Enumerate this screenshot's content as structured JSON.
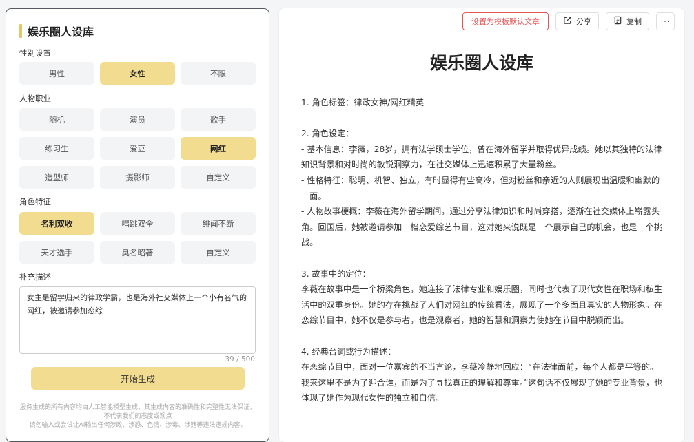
{
  "form": {
    "title": "娱乐圈人设库",
    "gender": {
      "label": "性别设置",
      "options": [
        "男性",
        "女性",
        "不限"
      ],
      "selected": "女性"
    },
    "profession": {
      "label": "人物职业",
      "options": [
        "随机",
        "演员",
        "歌手",
        "练习生",
        "爱豆",
        "网红",
        "造型师",
        "摄影师",
        "自定义"
      ],
      "selected": "网红"
    },
    "traits": {
      "label": "角色特征",
      "options": [
        "名利双收",
        "唱跳双全",
        "绯闻不断",
        "天才选手",
        "臭名昭著",
        "自定义"
      ],
      "selected": "名利双收"
    },
    "extra": {
      "label": "补充描述",
      "value": "女主是留学归来的律政学霸，也是海外社交媒体上一个小有名气的网红，被邀请参加恋综",
      "counter": "39 / 500"
    },
    "generate_label": "开始生成",
    "disclaimer": "服务生成的所有内容均由人工智能模型生成，其生成内容的准确性和完整性无法保证，不代表我们的态度或观点\n请勿输入或尝试让AI输出任何涉政、涉恐、色情、涉毒、涉赌等违法违规内容。"
  },
  "toolbar": {
    "set_default_label": "设置为模板默认文章",
    "share_label": "分享",
    "copy_label": "复制",
    "more_label": "···"
  },
  "article": {
    "title": "娱乐圈人设库",
    "paragraphs": [
      "1. 角色标签：律政女神/网红精英",
      "2. 角色设定：\n- 基本信息：李薇，28岁，拥有法学硕士学位，曾在海外留学并取得优异成绩。她以其独特的法律知识背景和对时尚的敏锐洞察力，在社交媒体上迅速积累了大量粉丝。\n- 性格特征：聪明、机智、独立，有时显得有些高冷，但对粉丝和亲近的人则展现出温暖和幽默的一面。\n- 人物故事梗概：李薇在海外留学期间，通过分享法律知识和时尚穿搭，逐渐在社交媒体上崭露头角。回国后，她被邀请参加一档恋爱综艺节目，这对她来说既是一个展示自己的机会，也是一个挑战。",
      "3. 故事中的定位：\n李薇在故事中是一个桥梁角色，她连接了法律专业和娱乐圈，同时也代表了现代女性在职场和私生活中的双重身份。她的存在挑战了人们对网红的传统看法，展现了一个多面且真实的人物形象。在恋综节目中，她不仅是参与者，也是观察者，她的智慧和洞察力使她在节目中脱颖而出。",
      "4. 经典台词或行为描述：\n在恋综节目中，面对一位嘉宾的不当言论，李薇冷静地回应：“在法律面前，每个人都是平等的。我来这里不是为了迎合谁，而是为了寻找真正的理解和尊重。”这句话不仅展现了她的专业背景，也体现了她作为现代女性的独立和自信。"
    ]
  }
}
